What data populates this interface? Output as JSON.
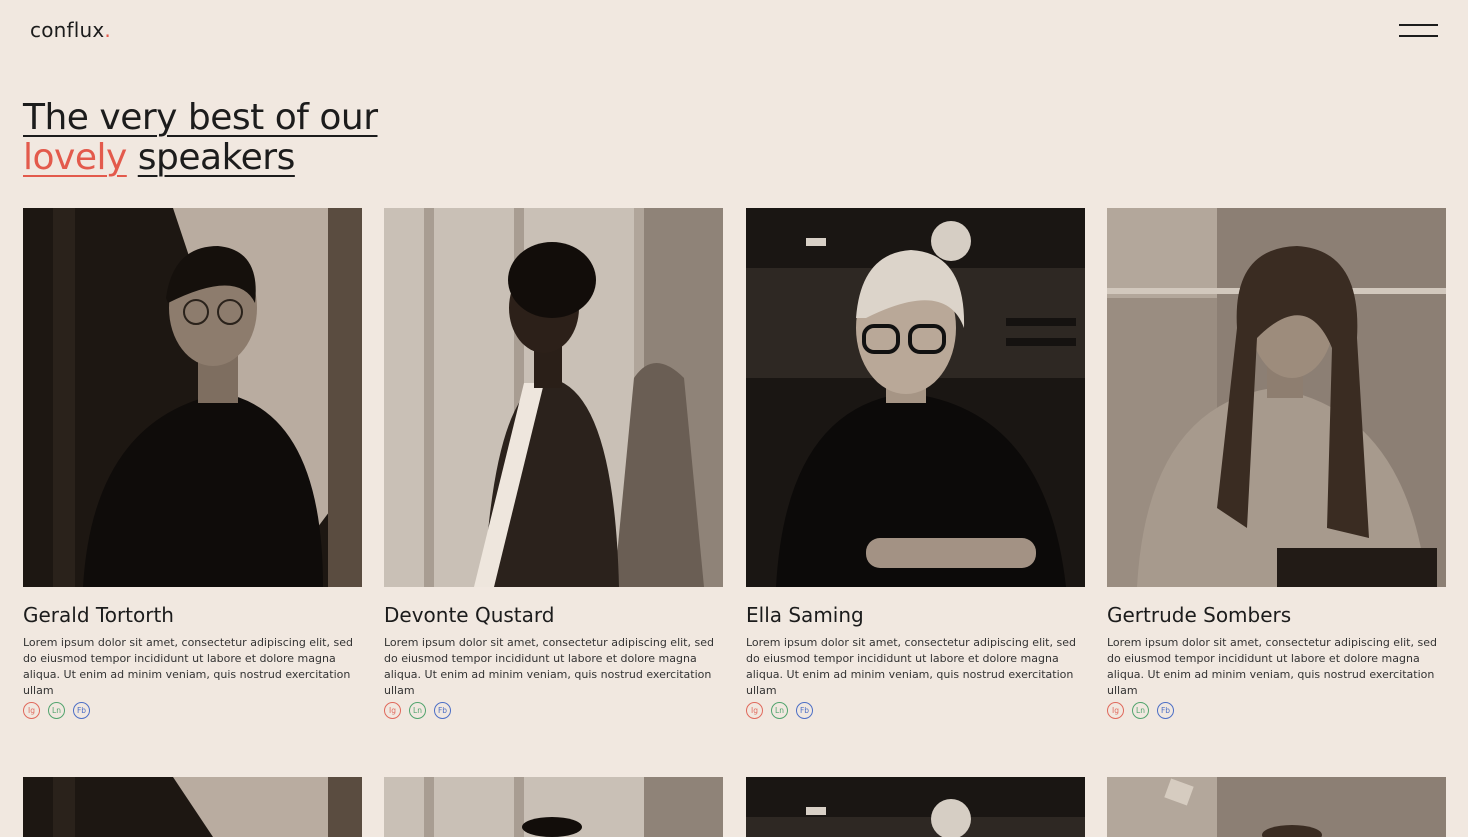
{
  "brand": {
    "name": "conflux",
    "dot": "."
  },
  "headline": {
    "line1": "The very best of our",
    "accent": "lovely",
    "rest": "speakers"
  },
  "speakers": [
    {
      "name": "Gerald Tortorth",
      "bio": "Lorem ipsum dolor sit amet, consectetur adipiscing elit, sed do eiusmod tempor incididunt ut labore et dolore magna aliqua. Ut enim ad minim veniam, quis nostrud exercitation ullam"
    },
    {
      "name": "Devonte Qustard",
      "bio": "Lorem ipsum dolor sit amet, consectetur adipiscing elit, sed do eiusmod tempor incididunt ut labore et dolore magna aliqua. Ut enim ad minim veniam, quis nostrud exercitation ullam"
    },
    {
      "name": "Ella Saming",
      "bio": "Lorem ipsum dolor sit amet, consectetur adipiscing elit, sed do eiusmod tempor incididunt ut labore et dolore magna aliqua. Ut enim ad minim veniam, quis nostrud exercitation ullam"
    },
    {
      "name": "Gertrude Sombers",
      "bio": "Lorem ipsum dolor sit amet, consectetur adipiscing elit, sed do eiusmod tempor incididunt ut labore et dolore magna aliqua. Ut enim ad minim veniam, quis nostrud exercitation ullam"
    }
  ],
  "social": {
    "ig": "Ig",
    "ln": "Ln",
    "fb": "Fb"
  },
  "colors": {
    "background": "#f1e8e0",
    "accent": "#e35a4c",
    "ig": "#e0695c",
    "ln": "#52a46e",
    "fb": "#4d6fc6"
  }
}
